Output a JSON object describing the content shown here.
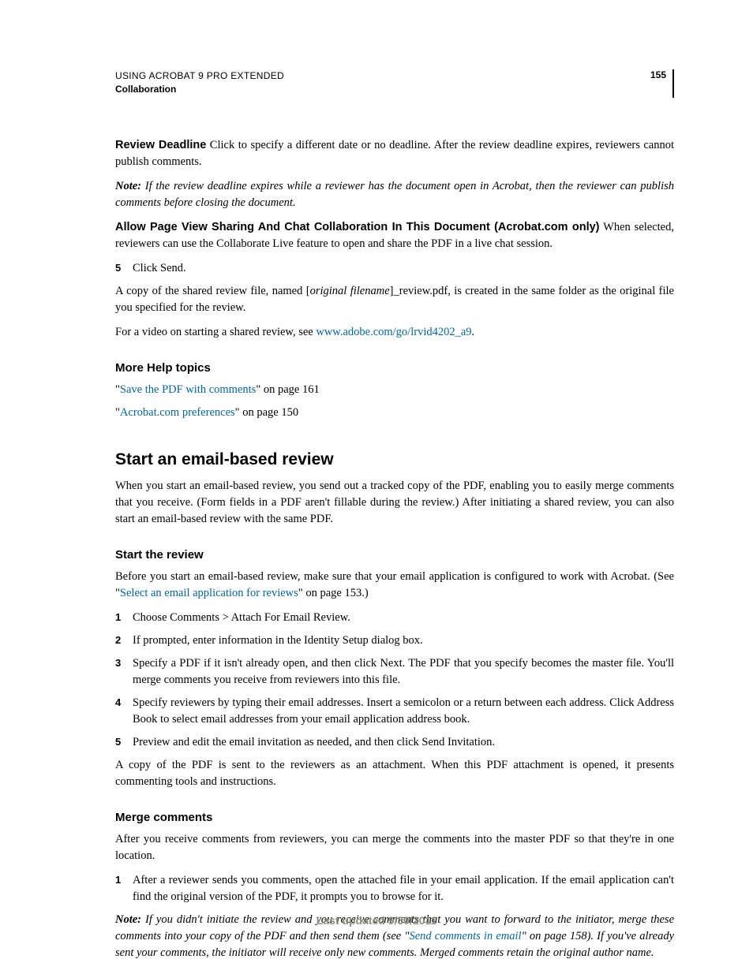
{
  "header": {
    "title": "USING ACROBAT 9 PRO EXTENDED",
    "section": "Collaboration",
    "page_number": "155"
  },
  "body": {
    "review_deadline_label": "Review Deadline",
    "review_deadline_text": "  Click to specify a different date or no deadline. After the review deadline expires, reviewers cannot publish comments.",
    "note1_label": "Note: ",
    "note1_text": "If the review deadline expires while a reviewer has the document open in Acrobat, then the reviewer can publish comments before closing the document.",
    "allow_label": "Allow Page View Sharing And Chat Collaboration In This Document (Acrobat.com only)",
    "allow_text": "  When selected, reviewers can use the Collaborate Live feature to open and share the PDF in a live chat session.",
    "step5_num": "5",
    "step5_text": "Click Send.",
    "copy_text_a": "A copy of the shared review file, named [",
    "copy_text_b": "original filename",
    "copy_text_c": "]_review.pdf, is created in the same folder as the original file you specified for the review.",
    "video_text_a": "For a video on starting a shared review, see ",
    "video_link": "www.adobe.com/go/lrvid4202_a9",
    "video_text_b": ".",
    "more_help_heading": "More Help topics",
    "more_help_1_link": "Save the PDF with comments",
    "more_help_1_suffix": "\" on page 161",
    "more_help_2_link": "Acrobat.com preferences",
    "more_help_2_suffix": "\" on page 150",
    "h2_start_email": "Start an email-based review",
    "start_email_intro": "When you start an email-based review, you send out a tracked copy of the PDF, enabling you to easily merge comments that you receive. (Form fields in a PDF aren't fillable during the review.) After initiating a shared review, you can also start an email-based review with the same PDF.",
    "h3_start_review": "Start the review",
    "start_review_intro_a": "Before you start an email-based review, make sure that your email application is configured to work with Acrobat. (See \"",
    "start_review_link": "Select an email application for reviews",
    "start_review_intro_b": "\" on page 153.)",
    "sr_steps": [
      {
        "n": "1",
        "t": "Choose Comments > Attach For Email Review."
      },
      {
        "n": "2",
        "t": "If prompted, enter information in the Identity Setup dialog box."
      },
      {
        "n": "3",
        "t": "Specify a PDF if it isn't already open, and then click Next. The PDF that you specify becomes the master file. You'll merge comments you receive from reviewers into this file."
      },
      {
        "n": "4",
        "t": "Specify reviewers by typing their email addresses. Insert a semicolon or a return between each address. Click Address Book to select email addresses from your email application address book."
      },
      {
        "n": "5",
        "t": "Preview and edit the email invitation as needed, and then click Send Invitation."
      }
    ],
    "sr_after": "A copy of the PDF is sent to the reviewers as an attachment. When this PDF attachment is opened, it presents commenting tools and instructions.",
    "h3_merge": "Merge comments",
    "merge_intro": "After you receive comments from reviewers, you can merge the comments into the master PDF so that they're in one location.",
    "merge_step_n": "1",
    "merge_step_t": "After a reviewer sends you comments, open the attached file in your email application. If the email application can't find the original version of the PDF, it prompts you to browse for it.",
    "note2_label": "Note: ",
    "note2_a": "If you didn't initiate the review and you receive comments that you want to forward to the initiator, merge these comments into your copy of the PDF and then send them (see \"",
    "note2_link": "Send comments in email",
    "note2_b": "\" on page 158). If you've already sent your comments, the initiator will receive only new comments. Merged comments retain the original author name."
  },
  "footer": {
    "updated": "Last updated 9/30/2011"
  }
}
